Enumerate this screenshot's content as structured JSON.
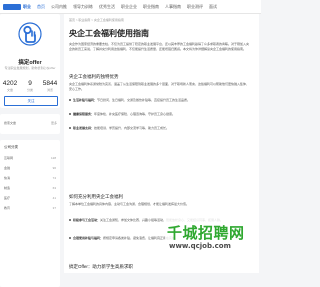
{
  "nav": {
    "logo_text": "职业",
    "items": [
      "首页",
      "公司内推",
      "领导力训练",
      "优秀生活",
      "职业企业",
      "职业指南",
      "人事指南",
      "职业测评",
      "面试"
    ]
  },
  "profile": {
    "name": "搞定offer",
    "desc": "专注职业发展规划，助你拿到心仪offer",
    "stats": [
      {
        "num": "4202",
        "label": "文章"
      },
      {
        "num": "9",
        "label": "分类"
      },
      {
        "num": "5844",
        "label": "浏览"
      }
    ],
    "follow_label": "关注"
  },
  "side_card": {
    "left": "搜索文章",
    "right": "更多"
  },
  "side_list": {
    "title": "公司分类",
    "rows": [
      {
        "name": "互联网",
        "count": "128"
      },
      {
        "name": "金融",
        "count": "96"
      },
      {
        "name": "快消",
        "count": "74"
      },
      {
        "name": "制造",
        "count": "63"
      },
      {
        "name": "医疗",
        "count": "41"
      },
      {
        "name": "教育",
        "count": "37"
      }
    ]
  },
  "article": {
    "breadcrumb": "首页 > 职业指南 > 央企工会福利使用指南",
    "title": "央企工会福利使用指南",
    "intro": "央企作为国家经济的重要支柱，不仅为员工提供了稳定的职业发展平台，还以其丰厚的工会福利赢得了众多求职者的青睐。对于刚加入央企的新员工来说，了解并充分利用这些福利，不仅能提升生活质量，还能增强归属感。本文将为你详细解读央企工会福利的使用指南。",
    "h2_1": "央企工会福利的独特优势",
    "p2": "央企工会福利体系通常较为完善，涵盖了从生活保障到职业发展的多个层面，对于职场新人而言，这些福利可以帮助他们更快融入集体、安心工作。",
    "bullets": [
      {
        "b": "生活补贴与福利：",
        "t": "节日慰问、生日福利、交通及餐饮补贴等，直接提升员工的生活品质。"
      },
      {
        "b": "健康保障服务：",
        "t": "年度体检、补充医疗保险、心理咨询等，守护员工身心健康。"
      },
      {
        "b": "职业发展支持：",
        "t": "技能培训、学历提升、内部交流学习等，助力员工成长。"
      }
    ],
    "h2_2": "如何充分利用央企工会福利",
    "p3": "了解本单位工会福利的具体内容，主动与工会沟通，合理规划，才能让福利发挥最大价值。",
    "tips": [
      {
        "b": "积极参与工会活动：",
        "t": "关注工会通知，参加文体比赛、兴趣小组等活动，既能放松身心，又能结识同事，拓展人脉。"
      },
      {
        "b": "合理使用补贴与福利：",
        "t": "按规定申请各类补贴，避免浪费，让福利真正用在实处。"
      }
    ]
  },
  "watermark": {
    "main": "千城招聘网",
    "url": "www.qcjob.com"
  },
  "footer": {
    "line": "搞定Offer：助力新学生高质求职"
  }
}
